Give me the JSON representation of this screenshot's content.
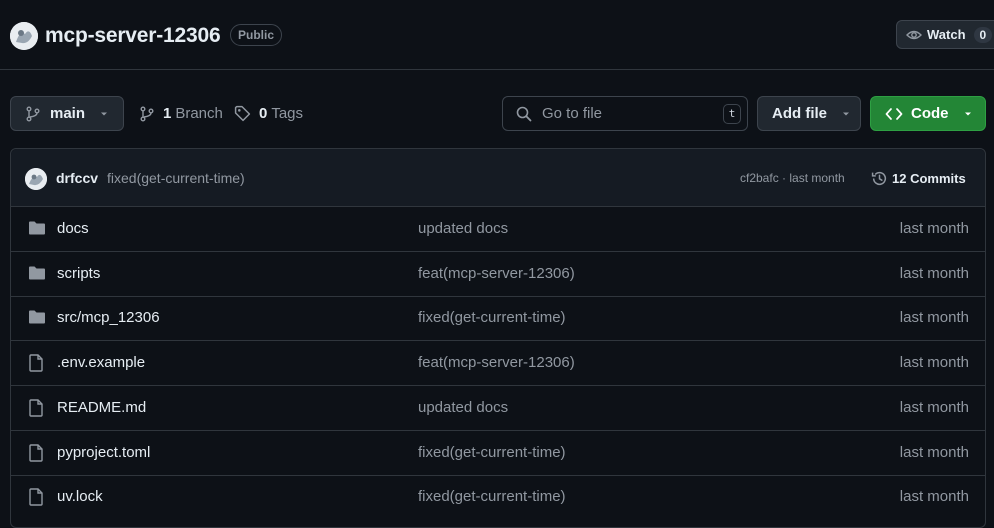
{
  "repo": {
    "name": "mcp-server-12306",
    "visibility": "Public",
    "watch_label": "Watch",
    "watch_count": "0"
  },
  "toolbar": {
    "branch": "main",
    "branch_count": "1",
    "branch_label": "Branch",
    "tag_count": "0",
    "tag_label": "Tags",
    "search_placeholder": "Go to file",
    "search_shortcut": "t",
    "add_file_label": "Add file",
    "code_label": "Code",
    "accent_color": "#238636"
  },
  "latest_commit": {
    "author": "drfccv",
    "message": "fixed(get-current-time)",
    "meta": "cf2bafc · last month",
    "commits_label": "12 Commits"
  },
  "files": [
    {
      "name": "docs",
      "type": "folder",
      "commit": "updated docs",
      "date": "last month"
    },
    {
      "name": "scripts",
      "type": "folder",
      "commit": "feat(mcp-server-12306)",
      "date": "last month"
    },
    {
      "name": "src/mcp_12306",
      "type": "folder",
      "commit": "fixed(get-current-time)",
      "date": "last month"
    },
    {
      "name": ".env.example",
      "type": "file",
      "commit": "feat(mcp-server-12306)",
      "date": "last month"
    },
    {
      "name": "README.md",
      "type": "file",
      "commit": "updated docs",
      "date": "last month"
    },
    {
      "name": "pyproject.toml",
      "type": "file",
      "commit": "fixed(get-current-time)",
      "date": "last month"
    },
    {
      "name": "uv.lock",
      "type": "file",
      "commit": "fixed(get-current-time)",
      "date": "last month"
    }
  ]
}
